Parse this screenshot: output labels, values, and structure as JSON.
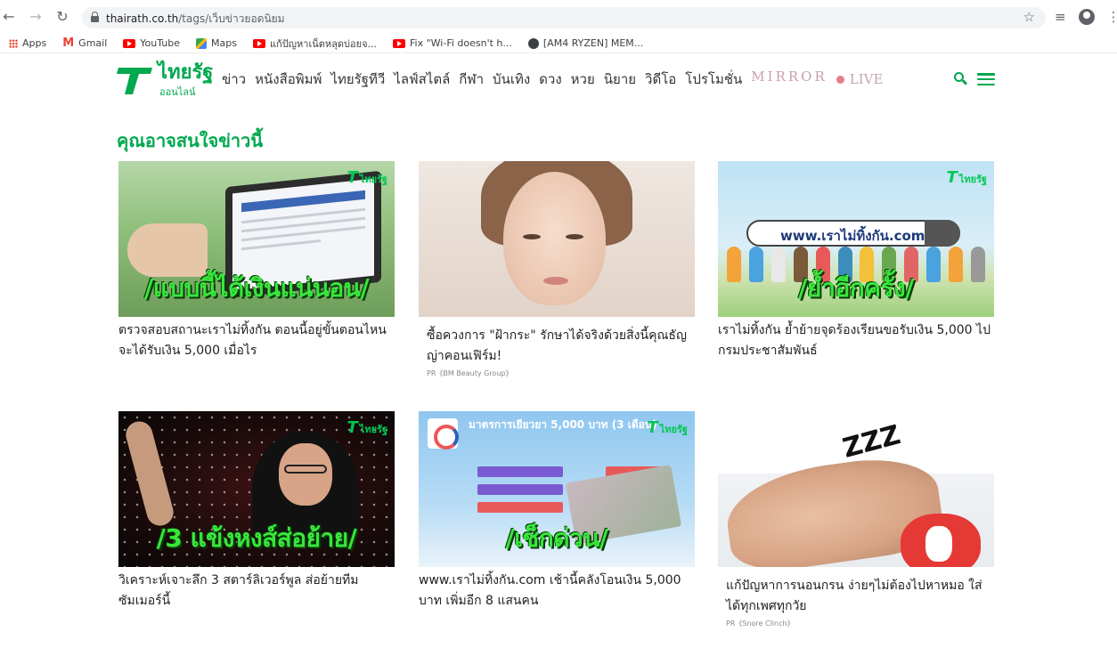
{
  "browser": {
    "url_host": "thairath.co.th",
    "url_path": "/tags/เว็บข่าวยอดนิยม",
    "bookmarks": [
      {
        "label": "Apps",
        "icon": "apps-icon"
      },
      {
        "label": "Gmail",
        "icon": "gmail-icon"
      },
      {
        "label": "YouTube",
        "icon": "youtube-icon"
      },
      {
        "label": "Maps",
        "icon": "maps-icon"
      },
      {
        "label": "แก้ปัญหาเน็ตหลุดบ่อยจ...",
        "icon": "youtube-icon"
      },
      {
        "label": "Fix \"Wi-Fi doesn't h...",
        "icon": "youtube-icon"
      },
      {
        "label": "[AM4 RYZEN] MEM...",
        "icon": "globe-icon"
      }
    ]
  },
  "site": {
    "logo_name": "ไทยรัฐ",
    "logo_sub": "ออนไลน์",
    "nav": [
      "ข่าว",
      "หนังสือพิมพ์",
      "ไทยรัฐทีวี",
      "ไลฟ์สไตล์",
      "กีฬา",
      "บันเทิง",
      "ดวง",
      "หวย",
      "นิยาย",
      "วิดีโอ",
      "โปรโมชั่น"
    ],
    "nav_mirror": "MIRROR",
    "nav_live": "LIVE",
    "accent": "#00a84f"
  },
  "section_title": "คุณอาจสนใจข่าวนี้",
  "cards": [
    {
      "thumb_caption": "/แบบนี้ได้เงินแน่นอน/",
      "thumb_logo": "ไทยรัฐ",
      "title": "ตรวจสอบสถานะเราไม่ทิ้งกัน ตอนนี้อยู่ขั้นตอนไหน จะได้รับเงิน 5,000 เมื่อไร",
      "sponsor": ""
    },
    {
      "thumb_caption": "",
      "thumb_logo": "",
      "title": "ซื้อควงการ \"ฝ้ากระ\" รักษาได้จริงด้วยสิ่งนี้คุณธัญญ่าคอนเฟิร์ม!",
      "sponsor": "PR《BM Beauty Group》"
    },
    {
      "thumb_caption": "/ย้ำอีกครั้ง/",
      "thumb_logo": "ไทยรัฐ",
      "thumb_url": "www.เราไม่ทิ้งกัน.com",
      "title": "เราไม่ทิ้งกัน ย้ำย้ายจุดร้องเรียนขอรับเงิน 5,000 ไปกรมประชาสัมพันธ์",
      "sponsor": ""
    },
    {
      "thumb_caption": "/3 แข้งหงส์ส่อย้าย/",
      "thumb_logo": "ไทยรัฐ",
      "title": "วิเคราะห์เจาะลึก 3 สตาร์ลิเวอร์พูล ส่อย้ายทีมซัมเมอร์นี้",
      "sponsor": ""
    },
    {
      "thumb_caption": "/เช็กด่วน/",
      "thumb_logo": "ไทยรัฐ",
      "thumb_head": "มาตรการเยียวยา 5,000 บาท (3 เดือน)",
      "title": "www.เราไม่ทิ้งกัน.com เช้านี้คลังโอนเงิน 5,000 บาท เพิ่มอีก 8 แสนคน",
      "sponsor": ""
    },
    {
      "thumb_caption": "",
      "thumb_logo": "",
      "thumb_zzz": "ZZZ",
      "title": "แก้ปัญหาการนอนกรน ง่ายๆไม่ต้องไปหาหมอ ใส่ได้ทุกเพศทุกวัย",
      "sponsor": "PR《Snore Clinch》"
    }
  ]
}
